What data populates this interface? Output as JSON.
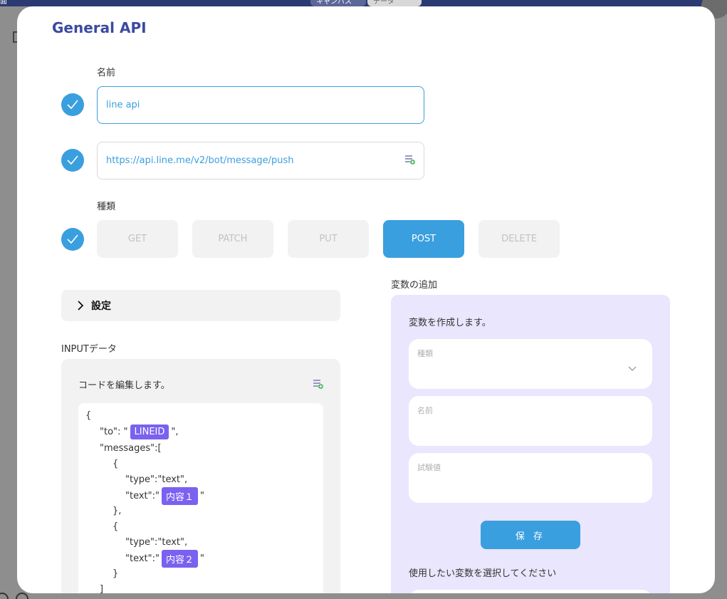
{
  "background": {
    "left_label": "面",
    "tabs": [
      "キャンバス",
      "データ"
    ]
  },
  "modal": {
    "title": "General API",
    "name_field": {
      "label": "名前",
      "value": "line api"
    },
    "url_field": {
      "value": "https://api.line.me/v2/bot/message/push",
      "icon": "add-variable-icon"
    },
    "method": {
      "label": "種類",
      "options": [
        "GET",
        "PATCH",
        "PUT",
        "POST",
        "DELETE"
      ],
      "selected": "POST"
    },
    "settings": {
      "label": "設定"
    },
    "input_data": {
      "section_label": "INPUTデータ",
      "panel_title": "コードを編集します。",
      "code": {
        "l1": "{",
        "l2_pre": "\"to\": \"",
        "l2_chip": "LINEID",
        "l2_post": "\",",
        "l3": "\"messages\":[",
        "l4": "{",
        "l5": "\"type\":\"text\",",
        "l6_pre": "\"text\":\"",
        "l6_chip": "内容１",
        "l6_post": "\"",
        "l7": "},",
        "l8": "{",
        "l9": "\"type\":\"text\",",
        "l10_pre": "\"text\":\"",
        "l10_chip": "内容２",
        "l10_post": "\"",
        "l11": "}",
        "l12": "]"
      }
    },
    "variables": {
      "section_label": "変数の追加",
      "panel_title": "変数を作成します。",
      "type_label": "種類",
      "name_label": "名前",
      "test_value_label": "試験値",
      "save_label": "保 存",
      "select_hint": "使用したい変数を選択してください"
    }
  },
  "colors": {
    "accent": "#3a9fde",
    "title": "#3b4aa0",
    "variable_chip": "#7b61f0",
    "variables_panel": "#e9e6fd"
  }
}
